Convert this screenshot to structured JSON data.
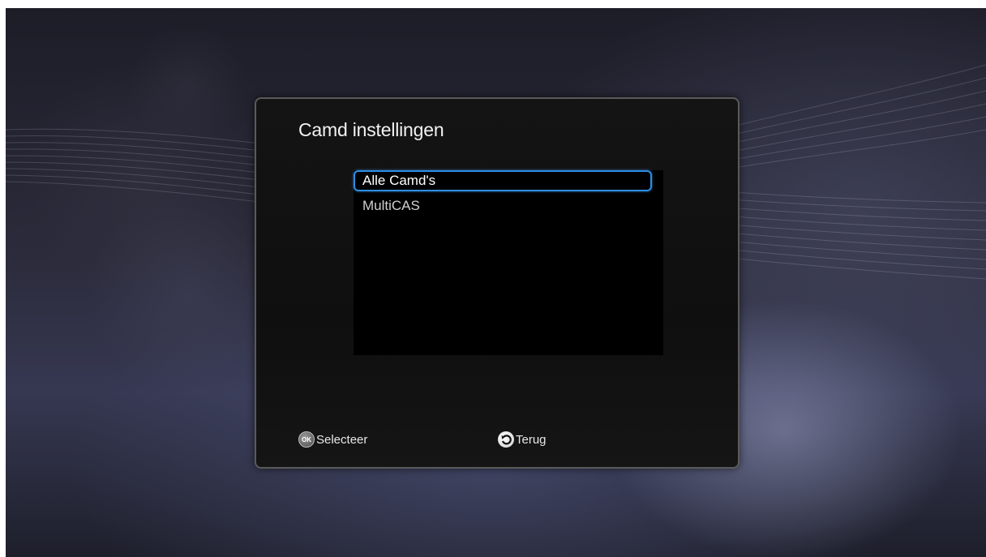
{
  "dialog": {
    "title": "Camd instellingen",
    "items": [
      {
        "label": "Alle Camd's",
        "selected": true
      },
      {
        "label": "MultiCAS",
        "selected": false
      }
    ]
  },
  "footer": {
    "select_label": "Selecteer",
    "select_icon": "ok-button-icon",
    "back_label": "Terug",
    "back_icon": "back-arrow-icon"
  },
  "colors": {
    "highlight": "#2f8de4",
    "dialog_bg": "#111111",
    "text": "#f2f2f2"
  }
}
